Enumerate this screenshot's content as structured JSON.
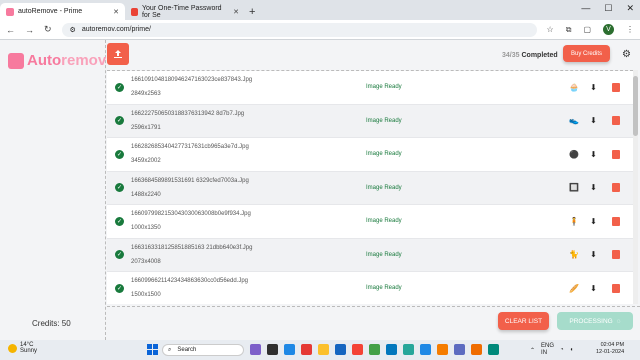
{
  "browser": {
    "tabs": [
      {
        "title": "autoRemove - Prime",
        "active": true
      },
      {
        "title": "Your One-Time Password for Se",
        "active": false
      }
    ],
    "url": "autoremov.com/prime/",
    "profile_initial": "V"
  },
  "app": {
    "logo_part1": "Auto",
    "logo_part2": "remov",
    "credits": "Credits: 50",
    "completed_count": "34/35",
    "completed_label": "Completed",
    "buy_credits": "Buy Credits",
    "clear_list": "CLEAR LIST",
    "processing": "PROCESSING",
    "accent": "#f2604a",
    "success": "#197a3d"
  },
  "files": [
    {
      "name": "1661091048180946247163023ce837843.Jpg",
      "dims": "2849x2563",
      "status": "Image Ready",
      "thumb": "🧁"
    },
    {
      "name": "1662227506503188376313942 8d7b7.Jpg",
      "dims": "2596x1791",
      "status": "Image Ready",
      "thumb": "👟"
    },
    {
      "name": "1662826853404277317631cb965a3e7d.Jpg",
      "dims": "3459x2002",
      "status": "Image Ready",
      "thumb": "⚫"
    },
    {
      "name": "1663684589891531691 6329cfed7003a.Jpg",
      "dims": "1488x2240",
      "status": "Image Ready",
      "thumb": "🔲"
    },
    {
      "name": "1660979982153043030063008b0e9f934.Jpg",
      "dims": "1000x1350",
      "status": "Image Ready",
      "thumb": "🧍"
    },
    {
      "name": "1663163318125851885163 21dbb640e3f.Jpg",
      "dims": "2073x4008",
      "status": "Image Ready",
      "thumb": "🐈"
    },
    {
      "name": "16609966211423434863630cc0d56edd.Jpg",
      "dims": "1500x1500",
      "status": "Image Ready",
      "thumb": "🥖"
    }
  ],
  "taskbar": {
    "temp": "14°C",
    "weather": "Sunny",
    "search": "Search",
    "lang1": "ENG",
    "lang2": "IN",
    "time": "02:04 PM",
    "date": "12-01-2024"
  }
}
